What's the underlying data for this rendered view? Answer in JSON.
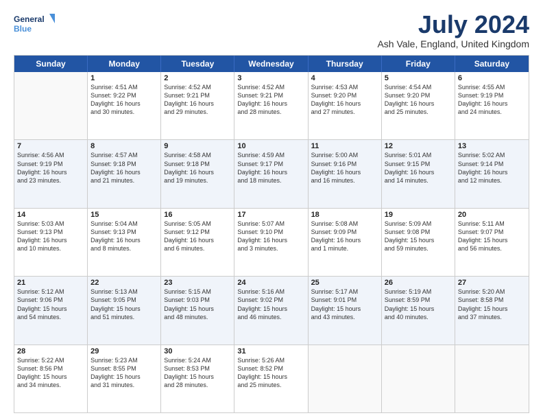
{
  "logo": {
    "line1": "General",
    "line2": "Blue"
  },
  "title": "July 2024",
  "location": "Ash Vale, England, United Kingdom",
  "days_of_week": [
    "Sunday",
    "Monday",
    "Tuesday",
    "Wednesday",
    "Thursday",
    "Friday",
    "Saturday"
  ],
  "weeks": [
    [
      {
        "day": "",
        "empty": true,
        "lines": []
      },
      {
        "day": "1",
        "empty": false,
        "lines": [
          "Sunrise: 4:51 AM",
          "Sunset: 9:22 PM",
          "Daylight: 16 hours",
          "and 30 minutes."
        ]
      },
      {
        "day": "2",
        "empty": false,
        "lines": [
          "Sunrise: 4:52 AM",
          "Sunset: 9:21 PM",
          "Daylight: 16 hours",
          "and 29 minutes."
        ]
      },
      {
        "day": "3",
        "empty": false,
        "lines": [
          "Sunrise: 4:52 AM",
          "Sunset: 9:21 PM",
          "Daylight: 16 hours",
          "and 28 minutes."
        ]
      },
      {
        "day": "4",
        "empty": false,
        "lines": [
          "Sunrise: 4:53 AM",
          "Sunset: 9:20 PM",
          "Daylight: 16 hours",
          "and 27 minutes."
        ]
      },
      {
        "day": "5",
        "empty": false,
        "lines": [
          "Sunrise: 4:54 AM",
          "Sunset: 9:20 PM",
          "Daylight: 16 hours",
          "and 25 minutes."
        ]
      },
      {
        "day": "6",
        "empty": false,
        "lines": [
          "Sunrise: 4:55 AM",
          "Sunset: 9:19 PM",
          "Daylight: 16 hours",
          "and 24 minutes."
        ]
      }
    ],
    [
      {
        "day": "7",
        "empty": false,
        "lines": [
          "Sunrise: 4:56 AM",
          "Sunset: 9:19 PM",
          "Daylight: 16 hours",
          "and 23 minutes."
        ]
      },
      {
        "day": "8",
        "empty": false,
        "lines": [
          "Sunrise: 4:57 AM",
          "Sunset: 9:18 PM",
          "Daylight: 16 hours",
          "and 21 minutes."
        ]
      },
      {
        "day": "9",
        "empty": false,
        "lines": [
          "Sunrise: 4:58 AM",
          "Sunset: 9:18 PM",
          "Daylight: 16 hours",
          "and 19 minutes."
        ]
      },
      {
        "day": "10",
        "empty": false,
        "lines": [
          "Sunrise: 4:59 AM",
          "Sunset: 9:17 PM",
          "Daylight: 16 hours",
          "and 18 minutes."
        ]
      },
      {
        "day": "11",
        "empty": false,
        "lines": [
          "Sunrise: 5:00 AM",
          "Sunset: 9:16 PM",
          "Daylight: 16 hours",
          "and 16 minutes."
        ]
      },
      {
        "day": "12",
        "empty": false,
        "lines": [
          "Sunrise: 5:01 AM",
          "Sunset: 9:15 PM",
          "Daylight: 16 hours",
          "and 14 minutes."
        ]
      },
      {
        "day": "13",
        "empty": false,
        "lines": [
          "Sunrise: 5:02 AM",
          "Sunset: 9:14 PM",
          "Daylight: 16 hours",
          "and 12 minutes."
        ]
      }
    ],
    [
      {
        "day": "14",
        "empty": false,
        "lines": [
          "Sunrise: 5:03 AM",
          "Sunset: 9:13 PM",
          "Daylight: 16 hours",
          "and 10 minutes."
        ]
      },
      {
        "day": "15",
        "empty": false,
        "lines": [
          "Sunrise: 5:04 AM",
          "Sunset: 9:13 PM",
          "Daylight: 16 hours",
          "and 8 minutes."
        ]
      },
      {
        "day": "16",
        "empty": false,
        "lines": [
          "Sunrise: 5:05 AM",
          "Sunset: 9:12 PM",
          "Daylight: 16 hours",
          "and 6 minutes."
        ]
      },
      {
        "day": "17",
        "empty": false,
        "lines": [
          "Sunrise: 5:07 AM",
          "Sunset: 9:10 PM",
          "Daylight: 16 hours",
          "and 3 minutes."
        ]
      },
      {
        "day": "18",
        "empty": false,
        "lines": [
          "Sunrise: 5:08 AM",
          "Sunset: 9:09 PM",
          "Daylight: 16 hours",
          "and 1 minute."
        ]
      },
      {
        "day": "19",
        "empty": false,
        "lines": [
          "Sunrise: 5:09 AM",
          "Sunset: 9:08 PM",
          "Daylight: 15 hours",
          "and 59 minutes."
        ]
      },
      {
        "day": "20",
        "empty": false,
        "lines": [
          "Sunrise: 5:11 AM",
          "Sunset: 9:07 PM",
          "Daylight: 15 hours",
          "and 56 minutes."
        ]
      }
    ],
    [
      {
        "day": "21",
        "empty": false,
        "lines": [
          "Sunrise: 5:12 AM",
          "Sunset: 9:06 PM",
          "Daylight: 15 hours",
          "and 54 minutes."
        ]
      },
      {
        "day": "22",
        "empty": false,
        "lines": [
          "Sunrise: 5:13 AM",
          "Sunset: 9:05 PM",
          "Daylight: 15 hours",
          "and 51 minutes."
        ]
      },
      {
        "day": "23",
        "empty": false,
        "lines": [
          "Sunrise: 5:15 AM",
          "Sunset: 9:03 PM",
          "Daylight: 15 hours",
          "and 48 minutes."
        ]
      },
      {
        "day": "24",
        "empty": false,
        "lines": [
          "Sunrise: 5:16 AM",
          "Sunset: 9:02 PM",
          "Daylight: 15 hours",
          "and 46 minutes."
        ]
      },
      {
        "day": "25",
        "empty": false,
        "lines": [
          "Sunrise: 5:17 AM",
          "Sunset: 9:01 PM",
          "Daylight: 15 hours",
          "and 43 minutes."
        ]
      },
      {
        "day": "26",
        "empty": false,
        "lines": [
          "Sunrise: 5:19 AM",
          "Sunset: 8:59 PM",
          "Daylight: 15 hours",
          "and 40 minutes."
        ]
      },
      {
        "day": "27",
        "empty": false,
        "lines": [
          "Sunrise: 5:20 AM",
          "Sunset: 8:58 PM",
          "Daylight: 15 hours",
          "and 37 minutes."
        ]
      }
    ],
    [
      {
        "day": "28",
        "empty": false,
        "lines": [
          "Sunrise: 5:22 AM",
          "Sunset: 8:56 PM",
          "Daylight: 15 hours",
          "and 34 minutes."
        ]
      },
      {
        "day": "29",
        "empty": false,
        "lines": [
          "Sunrise: 5:23 AM",
          "Sunset: 8:55 PM",
          "Daylight: 15 hours",
          "and 31 minutes."
        ]
      },
      {
        "day": "30",
        "empty": false,
        "lines": [
          "Sunrise: 5:24 AM",
          "Sunset: 8:53 PM",
          "Daylight: 15 hours",
          "and 28 minutes."
        ]
      },
      {
        "day": "31",
        "empty": false,
        "lines": [
          "Sunrise: 5:26 AM",
          "Sunset: 8:52 PM",
          "Daylight: 15 hours",
          "and 25 minutes."
        ]
      },
      {
        "day": "",
        "empty": true,
        "lines": []
      },
      {
        "day": "",
        "empty": true,
        "lines": []
      },
      {
        "day": "",
        "empty": true,
        "lines": []
      }
    ]
  ]
}
